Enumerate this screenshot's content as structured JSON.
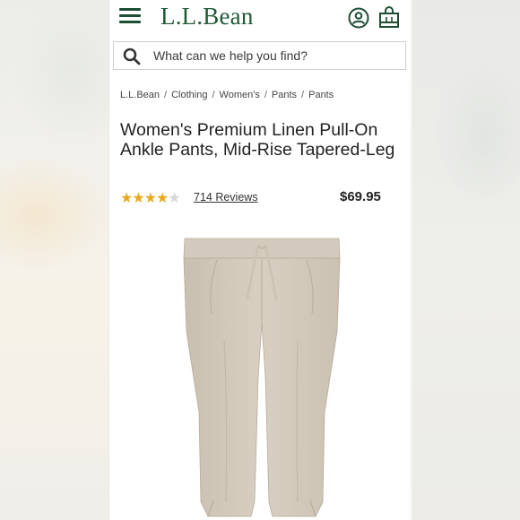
{
  "brand": {
    "logo_text": "L.L.Bean"
  },
  "search": {
    "placeholder": "What can we help you find?"
  },
  "breadcrumb": [
    "L.L.Bean",
    "Clothing",
    "Women's",
    "Pants",
    "Pants"
  ],
  "product": {
    "title": "Women's Premium Linen Pull-On Ankle Pants, Mid-Rise Tapered-Leg",
    "rating": 4,
    "rating_max": 5,
    "reviews_label": "714 Reviews",
    "price": "$69.95"
  },
  "icons": {
    "menu": "hamburger-menu-icon",
    "account": "account-icon",
    "bag": "shopping-bag-icon",
    "search": "search-icon"
  },
  "colors": {
    "brand_green": "#1f5a38",
    "star": "#e9a81e",
    "text": "#222222"
  }
}
